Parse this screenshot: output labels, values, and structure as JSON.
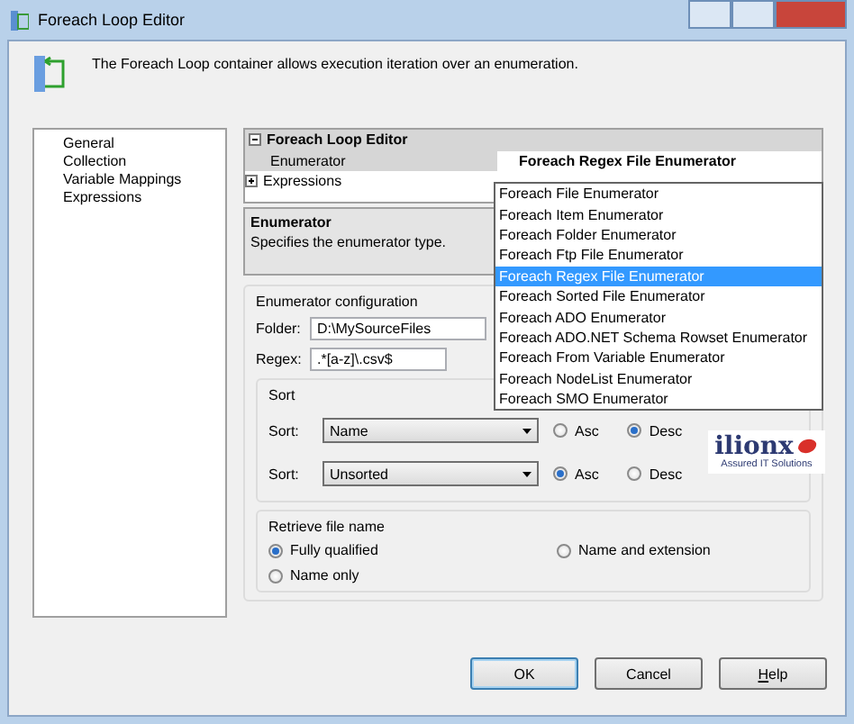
{
  "window": {
    "title": "Foreach Loop Editor"
  },
  "header": {
    "description": "The Foreach Loop container allows execution iteration over an enumeration."
  },
  "sidebar": {
    "items": [
      "General",
      "Collection",
      "Variable Mappings",
      "Expressions"
    ]
  },
  "property_grid": {
    "category": {
      "label": "Foreach Loop Editor",
      "expanded": true
    },
    "rows": [
      {
        "name": "Enumerator",
        "value": "Foreach Regex File Enumerator",
        "expanded": null
      },
      {
        "name": "Expressions",
        "value": "",
        "expanded": false
      }
    ]
  },
  "description": {
    "title": "Enumerator",
    "text": "Specifies the enumerator type."
  },
  "dropdown": {
    "options": [
      {
        "label": "Foreach File Enumerator",
        "selected": false
      },
      {
        "label": "Foreach Item Enumerator",
        "selected": false
      },
      {
        "label": "Foreach Folder Enumerator",
        "selected": false
      },
      {
        "label": "Foreach Ftp File Enumerator",
        "selected": false
      },
      {
        "label": "Foreach Regex File Enumerator",
        "selected": true
      },
      {
        "label": "Foreach Sorted File Enumerator",
        "selected": false
      },
      {
        "label": "Foreach ADO Enumerator",
        "selected": false
      },
      {
        "label": "Foreach ADO.NET Schema Rowset Enumerator",
        "selected": false
      },
      {
        "label": "Foreach From Variable Enumerator",
        "selected": false
      },
      {
        "label": "Foreach NodeList Enumerator",
        "selected": false
      },
      {
        "label": "Foreach SMO Enumerator",
        "selected": false
      }
    ]
  },
  "enumerator_configuration": {
    "title": "Enumerator configuration",
    "folder": {
      "label": "Folder:",
      "value": "D:\\MySourceFiles"
    },
    "regex": {
      "label": "Regex:",
      "value": ".*[a-z]\\.csv$"
    },
    "sort": {
      "title": "Sort",
      "rows": [
        {
          "label": "Sort:",
          "value": "Name",
          "options": [
            {
              "label": "Asc",
              "selected": false
            },
            {
              "label": "Desc",
              "selected": true
            }
          ]
        },
        {
          "label": "Sort:",
          "value": "Unsorted",
          "options": [
            {
              "label": "Asc",
              "selected": true
            },
            {
              "label": "Desc",
              "selected": false
            }
          ]
        }
      ]
    },
    "logo": {
      "name": "ilionx",
      "tagline": "Assured IT Solutions"
    },
    "retrieve_file_name": {
      "title": "Retrieve file name",
      "options": [
        {
          "label": "Fully qualified",
          "selected": true
        },
        {
          "label": "Name and extension",
          "selected": false
        },
        {
          "label": "Name only",
          "selected": false
        }
      ]
    }
  },
  "buttons": [
    {
      "label": "OK",
      "default": true
    },
    {
      "label": "Cancel",
      "default": false
    },
    {
      "label": "Help",
      "default": false
    }
  ]
}
